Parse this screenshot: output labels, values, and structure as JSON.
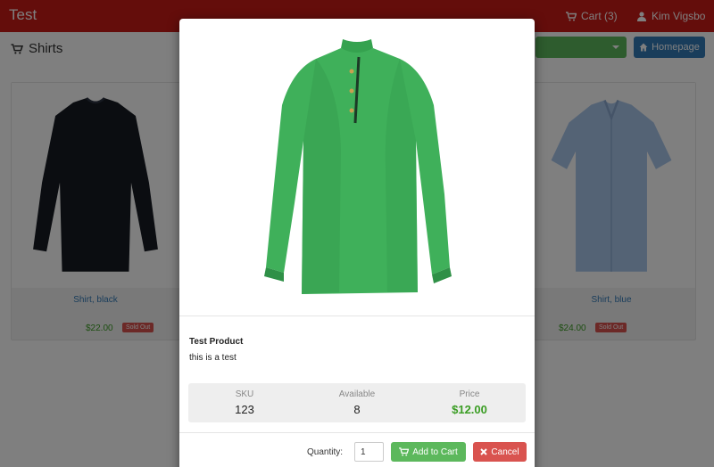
{
  "navbar": {
    "brand": "Test",
    "cart_label": "Cart (3)",
    "cart_icon": "cart-icon",
    "user_name": "Kim Vigsbo",
    "user_icon": "user-icon"
  },
  "subbar": {
    "heading": "Shirts",
    "heading_icon": "cart-icon",
    "homepage_label": "Homepage",
    "homepage_icon": "home-icon"
  },
  "products": [
    {
      "name": "Shirt, black",
      "price": "$22.00",
      "badge": "Sold Out",
      "shirt_color": "#161a22"
    },
    {
      "name": "Shirt, blue",
      "price": "$24.00",
      "badge": "Sold Out",
      "shirt_color": "#a9c6ea"
    }
  ],
  "modal": {
    "shirt_color": "#3fb05a",
    "title": "Test Product",
    "description": "this is a test",
    "stats": {
      "sku_label": "SKU",
      "sku_value": "123",
      "available_label": "Available",
      "available_value": "8",
      "price_label": "Price",
      "price_value": "$12.00"
    },
    "quantity_label": "Quantity:",
    "quantity_value": "1",
    "add_to_cart_label": "Add to Cart",
    "add_to_cart_icon": "cart-icon",
    "cancel_label": "Cancel",
    "cancel_icon": "close-icon"
  },
  "colors": {
    "navbar": "#c81a17",
    "success": "#5cb85c",
    "primary": "#337ab7",
    "danger": "#d9534f",
    "price_green": "#3a9d23"
  }
}
